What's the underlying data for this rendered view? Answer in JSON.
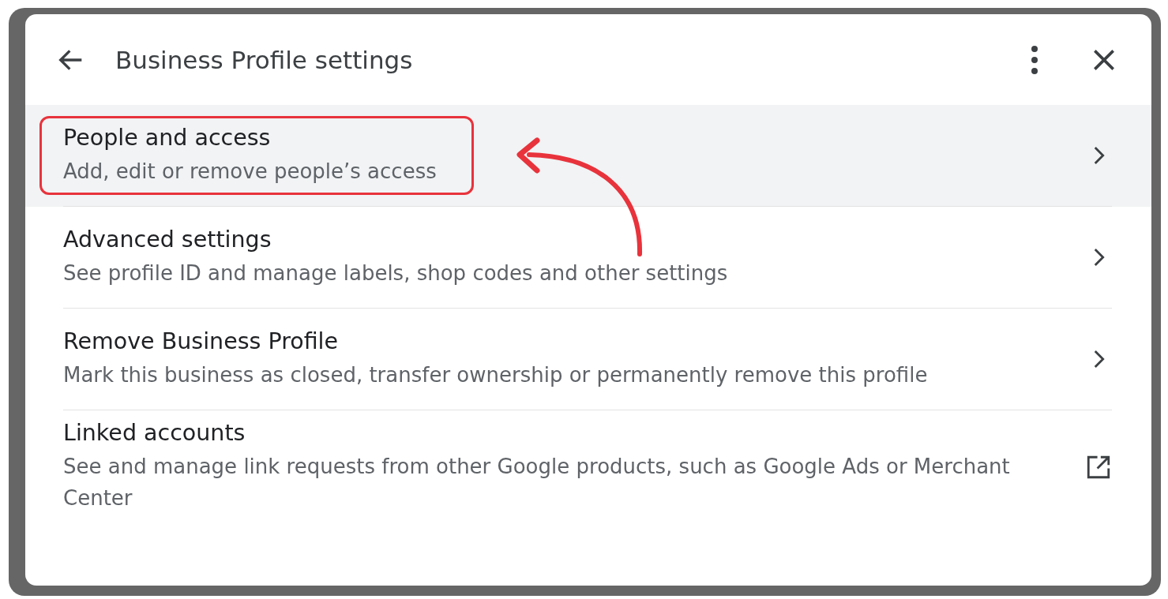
{
  "dialog": {
    "title": "Business Profile settings"
  },
  "rows": [
    {
      "title": "People and access",
      "subtitle": "Add, edit or remove people’s access",
      "kind": "chevron",
      "selected": true
    },
    {
      "title": "Advanced settings",
      "subtitle": "See profile ID and manage labels, shop codes and other settings",
      "kind": "chevron",
      "selected": false
    },
    {
      "title": "Remove Business Profile",
      "subtitle": "Mark this business as closed, transfer ownership or permanently remove this profile",
      "kind": "chevron",
      "selected": false
    },
    {
      "title": "Linked accounts",
      "subtitle": "See and manage link requests from other Google products, such as Google Ads or Merchant Center",
      "kind": "external",
      "selected": false
    }
  ]
}
